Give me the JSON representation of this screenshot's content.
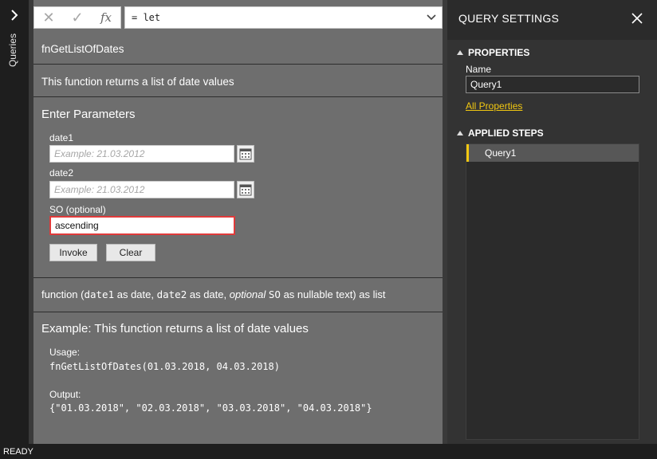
{
  "rail": {
    "label": "Queries"
  },
  "formula_bar": {
    "formula": "= let"
  },
  "function_name": "fnGetListOfDates",
  "description": "This function returns a list of date values",
  "params": {
    "heading": "Enter Parameters",
    "date1": {
      "label": "date1",
      "placeholder": "Example: 21.03.2012",
      "value": ""
    },
    "date2": {
      "label": "date2",
      "placeholder": "Example: 21.03.2012",
      "value": ""
    },
    "so": {
      "label": "SO (optional)",
      "value": "ascending"
    },
    "invoke_label": "Invoke",
    "clear_label": "Clear"
  },
  "signature": {
    "prefix": "function (",
    "p1": "date1",
    "t1": " as date, ",
    "p2": "date2",
    "t2": " as date, ",
    "opt": "optional",
    "p3": "SO",
    "t3": " as nullable text) as list"
  },
  "example": {
    "title": "Example: This function returns a list of date values",
    "usage_label": "Usage:",
    "usage_code": "fnGetListOfDates(01.03.2018, 04.03.2018)",
    "output_label": "Output:",
    "output_code": "{\"01.03.2018\", \"02.03.2018\", \"03.03.2018\", \"04.03.2018\"}"
  },
  "query_settings": {
    "title": "QUERY SETTINGS",
    "properties_heading": "PROPERTIES",
    "name_label": "Name",
    "name_value": "Query1",
    "all_properties_link": "All Properties",
    "applied_steps_heading": "APPLIED STEPS",
    "steps": [
      {
        "label": "Query1"
      }
    ]
  },
  "status": {
    "text": "READY"
  },
  "colors": {
    "accent": "#f2c811",
    "active_border": "#e03a3a"
  }
}
